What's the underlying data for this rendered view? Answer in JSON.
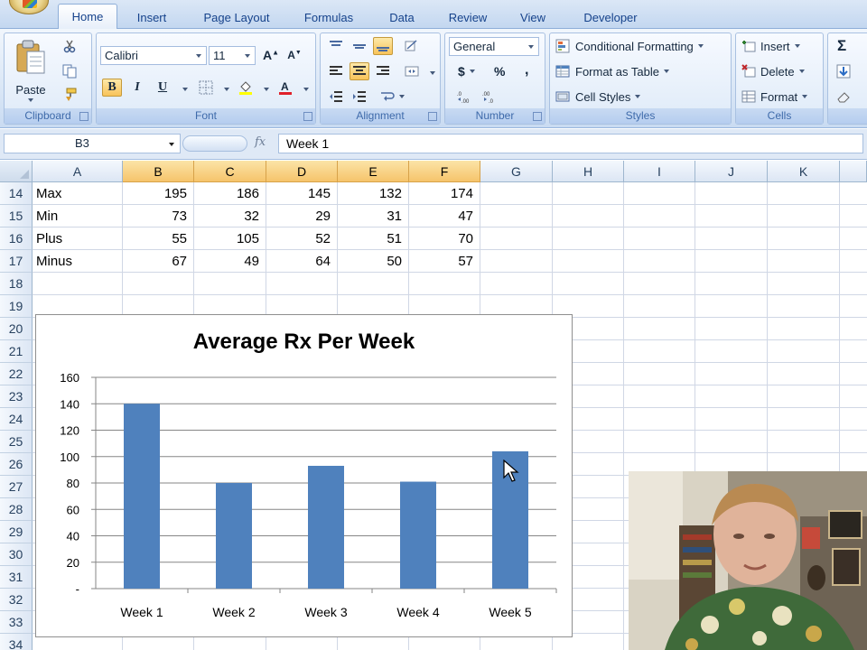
{
  "ribbon": {
    "tabs": [
      {
        "label": "Home",
        "active": true
      },
      {
        "label": "Insert",
        "active": false
      },
      {
        "label": "Page Layout",
        "active": false
      },
      {
        "label": "Formulas",
        "active": false
      },
      {
        "label": "Data",
        "active": false
      },
      {
        "label": "Review",
        "active": false
      },
      {
        "label": "View",
        "active": false
      },
      {
        "label": "Developer",
        "active": false
      }
    ],
    "clipboard": {
      "label": "Clipboard",
      "paste_label": "Paste"
    },
    "font": {
      "label": "Font",
      "font_name": "Calibri",
      "font_size": "11",
      "bold": "B",
      "italic": "I",
      "underline": "U"
    },
    "alignment": {
      "label": "Alignment"
    },
    "number": {
      "label": "Number",
      "format": "General",
      "currency": "$",
      "percent": "%",
      "comma": ","
    },
    "styles": {
      "label": "Styles",
      "conditional_formatting": "Conditional Formatting",
      "format_as_table": "Format as Table",
      "cell_styles": "Cell Styles"
    },
    "cells": {
      "label": "Cells",
      "insert": "Insert",
      "delete": "Delete",
      "format": "Format"
    },
    "editing": {
      "sum_symbol": "Σ"
    }
  },
  "formula_bar": {
    "name_box": "B3",
    "fx": "fx",
    "formula": "Week 1"
  },
  "sheet": {
    "columns": [
      "A",
      "B",
      "C",
      "D",
      "E",
      "F",
      "G",
      "H",
      "I",
      "J",
      "K"
    ],
    "selected_columns": [
      "B",
      "C",
      "D",
      "E",
      "F"
    ],
    "row_numbers": [
      "14",
      "15",
      "16",
      "17",
      "18",
      "19",
      "20",
      "21",
      "22",
      "23",
      "24",
      "25",
      "26",
      "27",
      "28",
      "29",
      "30",
      "31",
      "32",
      "33",
      "34"
    ],
    "rows": [
      {
        "label": "Max",
        "values": [
          "195",
          "186",
          "145",
          "132",
          "174"
        ]
      },
      {
        "label": "Min",
        "values": [
          "73",
          "32",
          "29",
          "31",
          "47"
        ]
      },
      {
        "label": "Plus",
        "values": [
          "55",
          "105",
          "52",
          "51",
          "70"
        ]
      },
      {
        "label": "Minus",
        "values": [
          "67",
          "49",
          "64",
          "50",
          "57"
        ]
      }
    ]
  },
  "chart_data": {
    "type": "bar",
    "title": "Average Rx Per Week",
    "categories": [
      "Week 1",
      "Week 2",
      "Week 3",
      "Week 4",
      "Week 5"
    ],
    "values": [
      140,
      80,
      93,
      81,
      104
    ],
    "yticks": [
      "-",
      "20",
      "40",
      "60",
      "80",
      "100",
      "120",
      "140",
      "160"
    ],
    "ylim": [
      0,
      160
    ],
    "bar_color": "#4f81bd",
    "grid": true
  }
}
